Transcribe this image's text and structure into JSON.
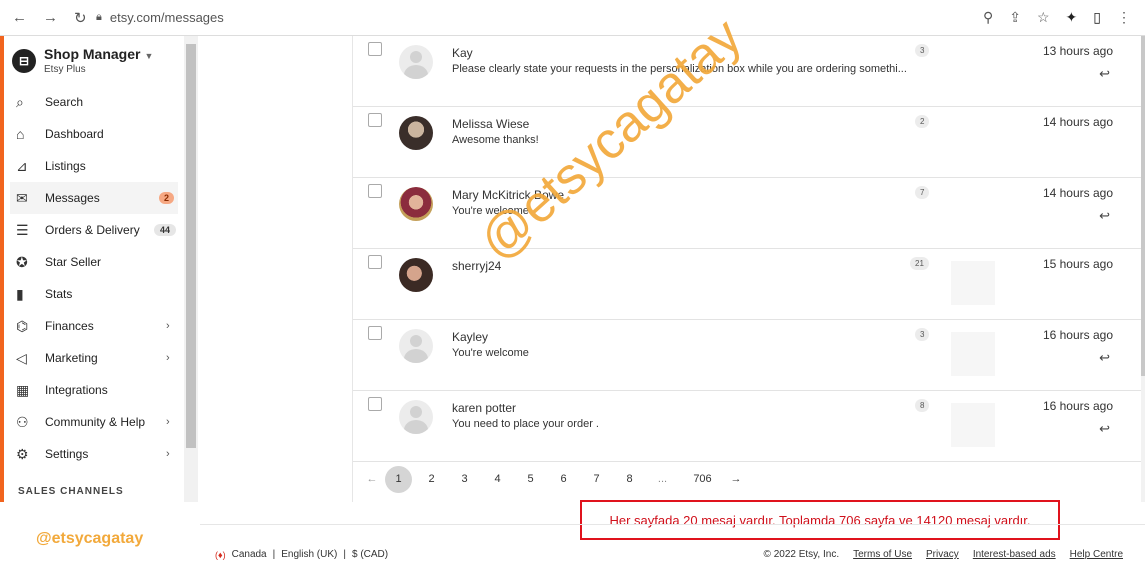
{
  "browser": {
    "url": "etsy.com/messages",
    "nav_icons": [
      "back-icon",
      "forward-icon",
      "reload-icon"
    ],
    "right_icons": [
      "zoom-icon",
      "share-icon",
      "star-icon",
      "extensions-icon",
      "sidepanel-icon",
      "menu-icon"
    ]
  },
  "sidebar": {
    "shop_name": "Shop Manager",
    "plan": "Etsy Plus",
    "items": [
      {
        "label": "Search",
        "icon": "search-icon",
        "glyph": "⌕"
      },
      {
        "label": "Dashboard",
        "icon": "home-icon",
        "glyph": "⌂"
      },
      {
        "label": "Listings",
        "icon": "listings-icon",
        "glyph": "⊿"
      },
      {
        "label": "Messages",
        "icon": "mail-icon",
        "glyph": "✉",
        "badge": "2"
      },
      {
        "label": "Orders & Delivery",
        "icon": "clipboard-icon",
        "glyph": "☰",
        "badge": "44"
      },
      {
        "label": "Star Seller",
        "icon": "star-seller-icon",
        "glyph": "✪"
      },
      {
        "label": "Stats",
        "icon": "stats-icon",
        "glyph": "▮"
      },
      {
        "label": "Finances",
        "icon": "bank-icon",
        "glyph": "⌬",
        "chevron": "›"
      },
      {
        "label": "Marketing",
        "icon": "megaphone-icon",
        "glyph": "◁",
        "chevron": "›"
      },
      {
        "label": "Integrations",
        "icon": "grid-icon",
        "glyph": "▦"
      },
      {
        "label": "Community & Help",
        "icon": "people-icon",
        "glyph": "⚇",
        "chevron": "›"
      },
      {
        "label": "Settings",
        "icon": "gear-icon",
        "glyph": "⚙",
        "chevron": "›"
      }
    ],
    "section_title": "SALES CHANNELS"
  },
  "messages": [
    {
      "name": "Kay",
      "preview": "Please clearly state your requests in the personalization box while you are ordering somethi...",
      "count": "3",
      "time": "13 hours ago",
      "reply": true,
      "avatar": "default"
    },
    {
      "name": "Melissa Wiese",
      "preview": "Awesome thanks!",
      "count": "2",
      "time": "14 hours ago",
      "reply": false,
      "avatar": "photo1"
    },
    {
      "name": "Mary McKitrick Bowe",
      "preview": "You're welcome",
      "count": "7",
      "time": "14 hours ago",
      "reply": true,
      "avatar": "photo2"
    },
    {
      "name": "sherryj24",
      "preview": "",
      "count": "21",
      "time": "15 hours ago",
      "reply": false,
      "avatar": "photo3"
    },
    {
      "name": "Kayley",
      "preview": "You're welcome",
      "count": "3",
      "time": "16 hours ago",
      "reply": true,
      "avatar": "default"
    },
    {
      "name": "karen potter",
      "preview": "You need to place your order .",
      "count": "8",
      "time": "16 hours ago",
      "reply": true,
      "avatar": "default"
    }
  ],
  "pagination": {
    "prev": "←",
    "pages": [
      "1",
      "2",
      "3",
      "4",
      "5",
      "6",
      "7",
      "8"
    ],
    "current": "1",
    "ellipsis": "...",
    "last": "706",
    "next": "→"
  },
  "note": "Her sayfada 20 mesaj vardır. Toplamda 706 sayfa ve 14120 mesaj vardır.",
  "watermark": "@etsycagatay",
  "watermark_bottom": "@etsycagatay",
  "footer": {
    "country": "Canada",
    "language": "English (UK)",
    "currency": "$ (CAD)",
    "copyright": "© 2022 Etsy, Inc.",
    "links": [
      "Terms of Use",
      "Privacy",
      "Interest-based ads",
      "Help Centre"
    ]
  },
  "colors": {
    "accent": "#f1641e",
    "watermark": "#f2a93b",
    "note_red": "#e0131d"
  }
}
